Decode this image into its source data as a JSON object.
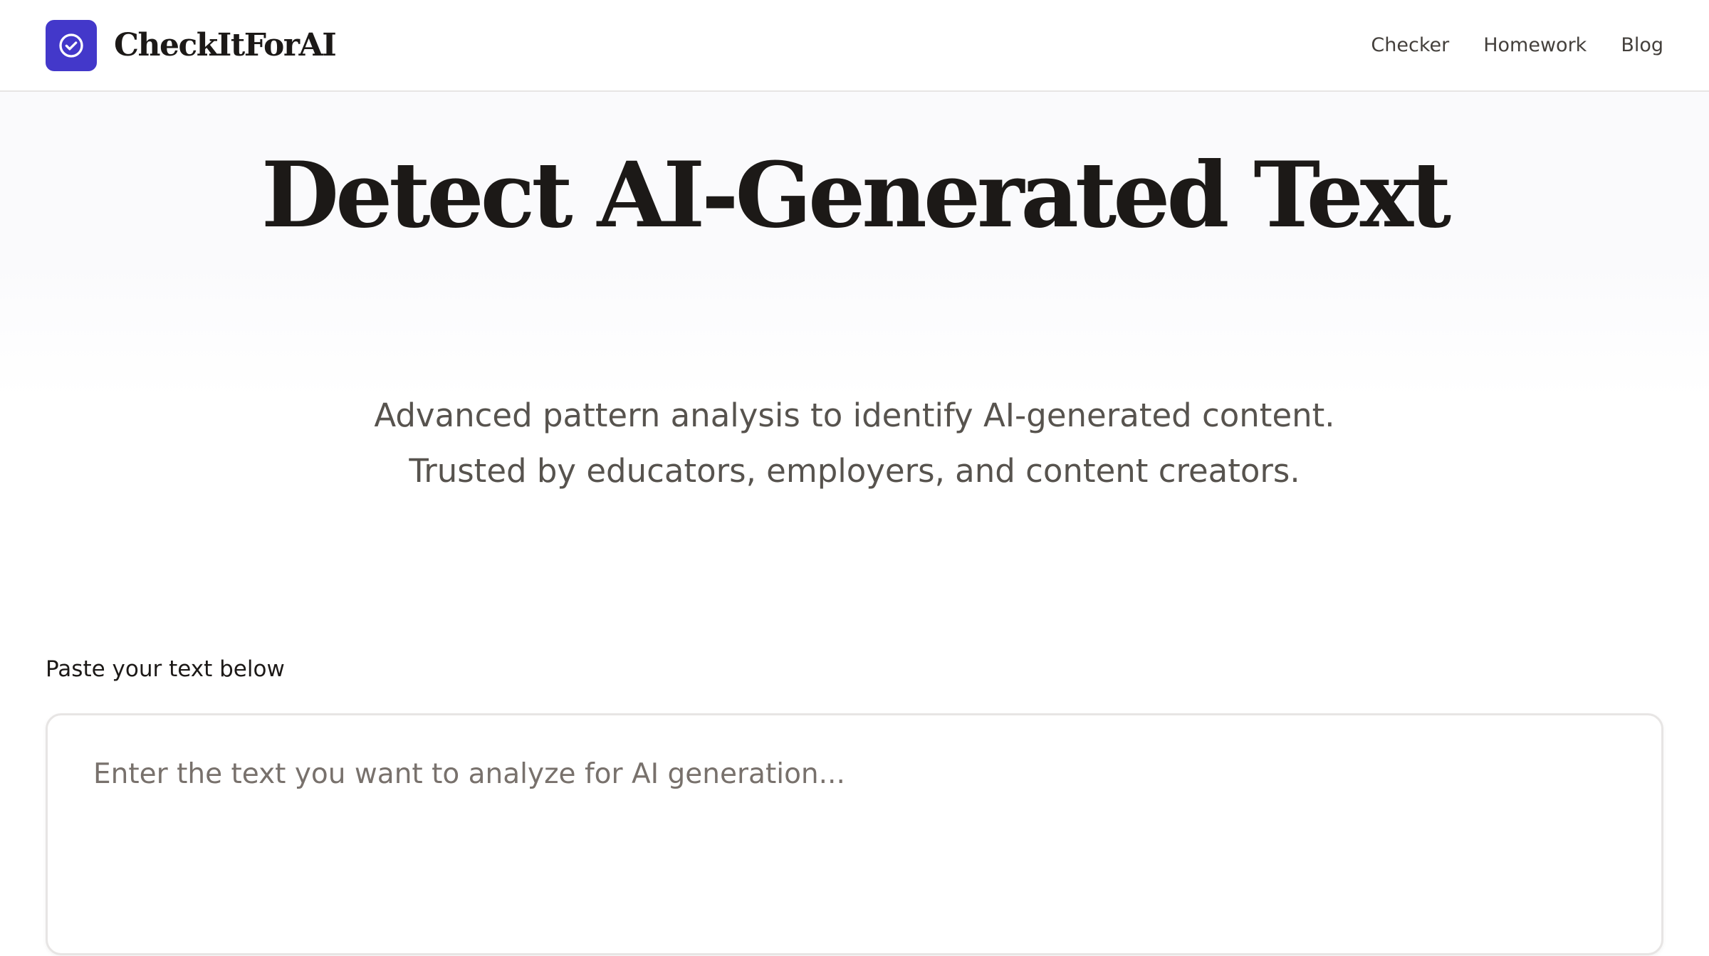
{
  "header": {
    "brand_name": "CheckItForAI",
    "nav": [
      {
        "label": "Checker"
      },
      {
        "label": "Homework"
      },
      {
        "label": "Blog"
      }
    ]
  },
  "hero": {
    "title": "Detect AI-Generated Text",
    "subtitle_line1": "Advanced pattern analysis to identify AI-generated content.",
    "subtitle_line2": "Trusted by educators, employers, and content creators."
  },
  "input": {
    "label": "Paste your text below",
    "placeholder": "Enter the text you want to analyze for AI generation...",
    "value": ""
  },
  "colors": {
    "brand_accent": "#4338ca",
    "text_primary": "#1c1917",
    "text_muted": "#57534e",
    "border": "#e7e5e4"
  },
  "icons": {
    "logo": "check-circle-icon"
  }
}
